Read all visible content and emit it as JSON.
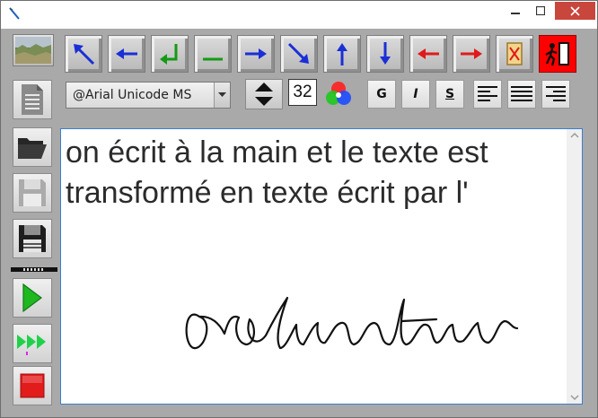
{
  "window": {
    "controls": [
      "minimize",
      "maximize",
      "close"
    ]
  },
  "toolbar": {
    "top_buttons": [
      {
        "id": "image-thumbnail",
        "icon": "landscape-photo-icon"
      },
      {
        "id": "move-up-left",
        "icon": "arrow-up-left-icon",
        "color": "#1a2fd6"
      },
      {
        "id": "move-left",
        "icon": "arrow-left-icon",
        "color": "#1a2fd6"
      },
      {
        "id": "line-return",
        "icon": "return-arrow-icon",
        "color": "#149a14"
      },
      {
        "id": "underscore",
        "icon": "underscore-bar-icon",
        "color": "#149a14"
      },
      {
        "id": "move-right",
        "icon": "arrow-right-icon",
        "color": "#1a2fd6"
      },
      {
        "id": "move-down-right",
        "icon": "arrow-down-right-icon",
        "color": "#1a2fd6"
      },
      {
        "id": "move-up",
        "icon": "arrow-up-icon",
        "color": "#1a2fd6"
      },
      {
        "id": "move-down",
        "icon": "arrow-down-icon",
        "color": "#1a2fd6"
      },
      {
        "id": "delete-left",
        "icon": "arrow-left-icon",
        "color": "#e01a1a"
      },
      {
        "id": "delete-right",
        "icon": "arrow-right-icon",
        "color": "#e01a1a"
      },
      {
        "id": "clear",
        "icon": "cancel-card-icon",
        "color": "#e01a1a"
      },
      {
        "id": "exit",
        "icon": "exit-door-icon",
        "color": "#ff0000"
      }
    ]
  },
  "format_bar": {
    "font_name": "@Arial Unicode MS",
    "font_size": "32",
    "bold_label": "G",
    "italic_label": "I",
    "underline_label": "S",
    "align_options": [
      "left",
      "justify",
      "right"
    ]
  },
  "sidebar": {
    "buttons": [
      {
        "id": "new-document",
        "icon": "document-icon"
      },
      {
        "id": "open-folder",
        "icon": "folder-open-icon"
      },
      {
        "id": "save",
        "icon": "floppy-disk-icon"
      },
      {
        "id": "save-as",
        "icon": "floppy-disk-dark-icon"
      },
      {
        "id": "play",
        "icon": "play-icon",
        "color": "#1fb81f"
      },
      {
        "id": "play-all",
        "icon": "fast-forward-icon",
        "color": "#1fd14a"
      },
      {
        "id": "stop",
        "icon": "stop-icon",
        "color": "#e21b1b"
      }
    ]
  },
  "editor": {
    "text": "on écrit à la main et le texte est transformé en texte écrit par l'"
  }
}
